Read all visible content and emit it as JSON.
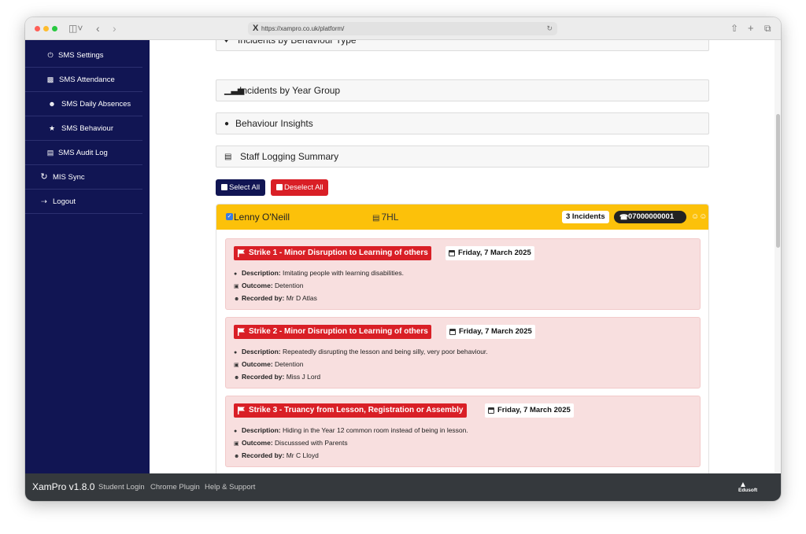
{
  "browser": {
    "url": "https://xampro.co.uk/platform/",
    "url_logo": "X"
  },
  "sidebar": {
    "items": [
      {
        "label": "SMS Settings",
        "icon": "plug-icon"
      },
      {
        "label": "SMS Attendance",
        "icon": "calendar-check-icon"
      },
      {
        "label": "SMS Daily Absences",
        "icon": "user-x-icon"
      },
      {
        "label": "SMS Behaviour",
        "icon": "users-icon"
      },
      {
        "label": "SMS Audit Log",
        "icon": "clipboard-icon"
      },
      {
        "label": "MIS Sync",
        "icon": "sync-icon"
      },
      {
        "label": "Logout",
        "icon": "logout-icon"
      }
    ]
  },
  "accordions": [
    {
      "label": "Incidents by Behaviour Type",
      "icon": "tag-icon"
    },
    {
      "label": "Incidents by Year Group",
      "icon": "bar-chart-icon"
    },
    {
      "label": "Behaviour Insights",
      "icon": "lightbulb-icon"
    },
    {
      "label": "Staff Logging Summary",
      "icon": "teacher-icon"
    }
  ],
  "buttons": {
    "select_all": "Select All",
    "deselect_all": "Deselect All"
  },
  "student": {
    "name": "Lenny O'Neill",
    "form": "7HL",
    "incident_count": "3 Incidents",
    "phone": "07000000001"
  },
  "labels": {
    "description": "Description:",
    "outcome": "Outcome:",
    "recorded_by": "Recorded by:"
  },
  "incidents": [
    {
      "title": "Strike 1 - Minor Disruption to Learning of others",
      "date": "Friday, 7 March 2025",
      "description": "Imitating people with learning disabilities.",
      "outcome": "Detention",
      "recorded_by": "Mr D Atlas"
    },
    {
      "title": "Strike 2 - Minor Disruption to Learning of others",
      "date": "Friday, 7 March 2025",
      "description": "Repeatedly disrupting the lesson and being silly, very poor behaviour.",
      "outcome": "Detention",
      "recorded_by": "Miss J Lord"
    },
    {
      "title": "Strike 3 - Truancy from Lesson, Registration or Assembly",
      "date": "Friday, 7 March 2025",
      "description": "Hiding in the Year 12 common room instead of being in lesson.",
      "outcome": "Discusssed with Parents",
      "recorded_by": "Mr C Lloyd"
    }
  ],
  "footer": {
    "brand": "XamPro v1.8.0",
    "links": [
      "Student Login",
      "Chrome Plugin",
      "Help & Support"
    ],
    "logo_text": "Edusoft"
  },
  "colors": {
    "sidebar": "#111553",
    "student_header": "#fcc10a",
    "strike_red": "#d91f26",
    "incident_bg": "#f8dfdf",
    "footer": "#35393d"
  }
}
